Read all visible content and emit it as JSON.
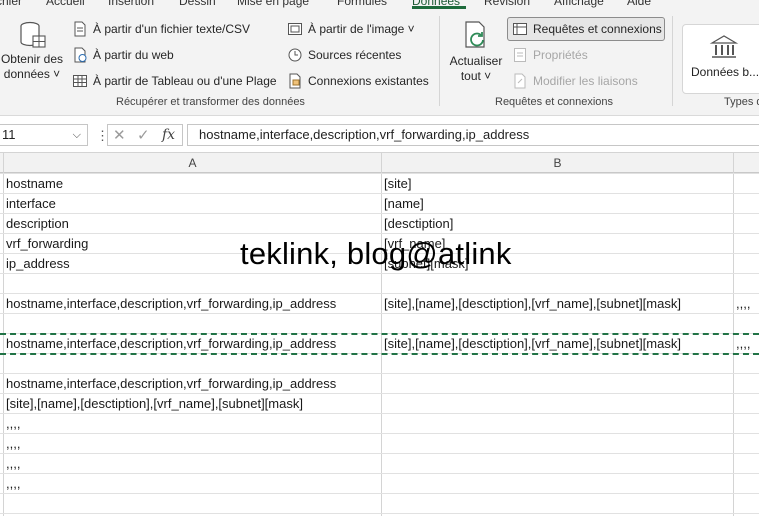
{
  "tabs": [
    "chier",
    "Accueil",
    "Insertion",
    "Dessin",
    "Mise en page",
    "Formules",
    "Données",
    "Révision",
    "Affichage",
    "Aide"
  ],
  "active_tab": "Données",
  "ribbon": {
    "get_data": {
      "line1": "Obtenir des",
      "line2": "données ˅"
    },
    "from_text_csv": "À partir d'un fichier texte/CSV",
    "from_web": "À partir du web",
    "from_table": "À partir de Tableau ou d'une Plage",
    "from_image": "À partir de l'image ˅",
    "recent_sources": "Sources récentes",
    "existing_connections": "Connexions existantes",
    "group1_label": "Récupérer et transformer des données",
    "refresh_all": {
      "line1": "Actualiser",
      "line2": "tout ˅"
    },
    "queries_connections": "Requêtes et connexions",
    "properties": "Propriétés",
    "edit_links": "Modifier les liaisons",
    "group2_label": "Requêtes et connexions",
    "data_types": "Données b...",
    "group3_label": "Types d"
  },
  "formula_bar": {
    "name_box": "11",
    "content": "hostname,interface,description,vrf_forwarding,ip_address"
  },
  "columns": [
    "A",
    "B"
  ],
  "rows": [
    {
      "a": "hostname",
      "b": "[site]",
      "c": ""
    },
    {
      "a": "interface",
      "b": "[name]",
      "c": ""
    },
    {
      "a": "description",
      "b": "[desctiption]",
      "c": ""
    },
    {
      "a": "vrf_forwarding",
      "b": "[vrf_name]",
      "c": ""
    },
    {
      "a": "ip_address",
      "b": "[subnet][mask]",
      "c": ""
    },
    {
      "a": "",
      "b": "",
      "c": ""
    },
    {
      "a": "hostname,interface,description,vrf_forwarding,ip_address",
      "b": "[site],[name],[desctiption],[vrf_name],[subnet][mask]",
      "c": ",,,,"
    },
    {
      "a": "",
      "b": "",
      "c": ""
    },
    {
      "a": "hostname,interface,description,vrf_forwarding,ip_address",
      "b": "[site],[name],[desctiption],[vrf_name],[subnet][mask]",
      "c": ",,,,"
    },
    {
      "a": "",
      "b": "",
      "c": ""
    },
    {
      "a": "hostname,interface,description,vrf_forwarding,ip_address",
      "b": "",
      "c": ""
    },
    {
      "a": "[site],[name],[desctiption],[vrf_name],[subnet][mask]",
      "b": "",
      "c": ""
    },
    {
      "a": ",,,,",
      "b": "",
      "c": ""
    },
    {
      "a": ",,,,",
      "b": "",
      "c": ""
    },
    {
      "a": ",,,,",
      "b": "",
      "c": ""
    },
    {
      "a": ",,,,",
      "b": "",
      "c": ""
    }
  ],
  "watermark": "teklink, blog@atlink",
  "colors": {
    "accent": "#217346",
    "ribbon_bg": "#f3f3f3"
  }
}
